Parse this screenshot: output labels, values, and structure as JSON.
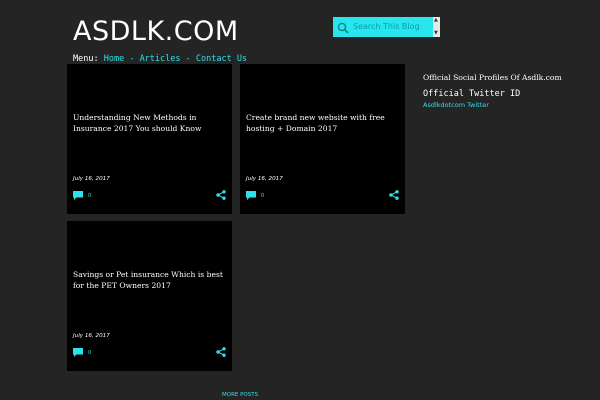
{
  "site": {
    "title": "ASDLK.COM"
  },
  "menu": {
    "label": "Menu:",
    "items": [
      {
        "label": "Home"
      },
      {
        "label": "Articles"
      },
      {
        "label": "Contact Us"
      }
    ],
    "separator": " - "
  },
  "search": {
    "placeholder": "Search This Blog"
  },
  "posts": [
    {
      "title": "Understanding New Methods in Insurance 2017 You should Know",
      "date": "July 16, 2017",
      "comments": "0"
    },
    {
      "title": "Create brand new website with free hosting + Domain 2017",
      "date": "July 16, 2017",
      "comments": "0"
    },
    {
      "title": "Savings or Pet insurance Which is best for the PET Owners 2017",
      "date": "July 16, 2017",
      "comments": "0"
    }
  ],
  "sidebar": {
    "widget1_title": "Official Social Profiles Of Asdlk.com",
    "widget2_title": "Official Twitter ID",
    "twitter_link": "Asdlkdotcom Twitter"
  },
  "footer": {
    "more_posts": "MORE POSTS"
  },
  "colors": {
    "accent": "#27e6f0",
    "background": "#242424",
    "card": "#000000"
  }
}
